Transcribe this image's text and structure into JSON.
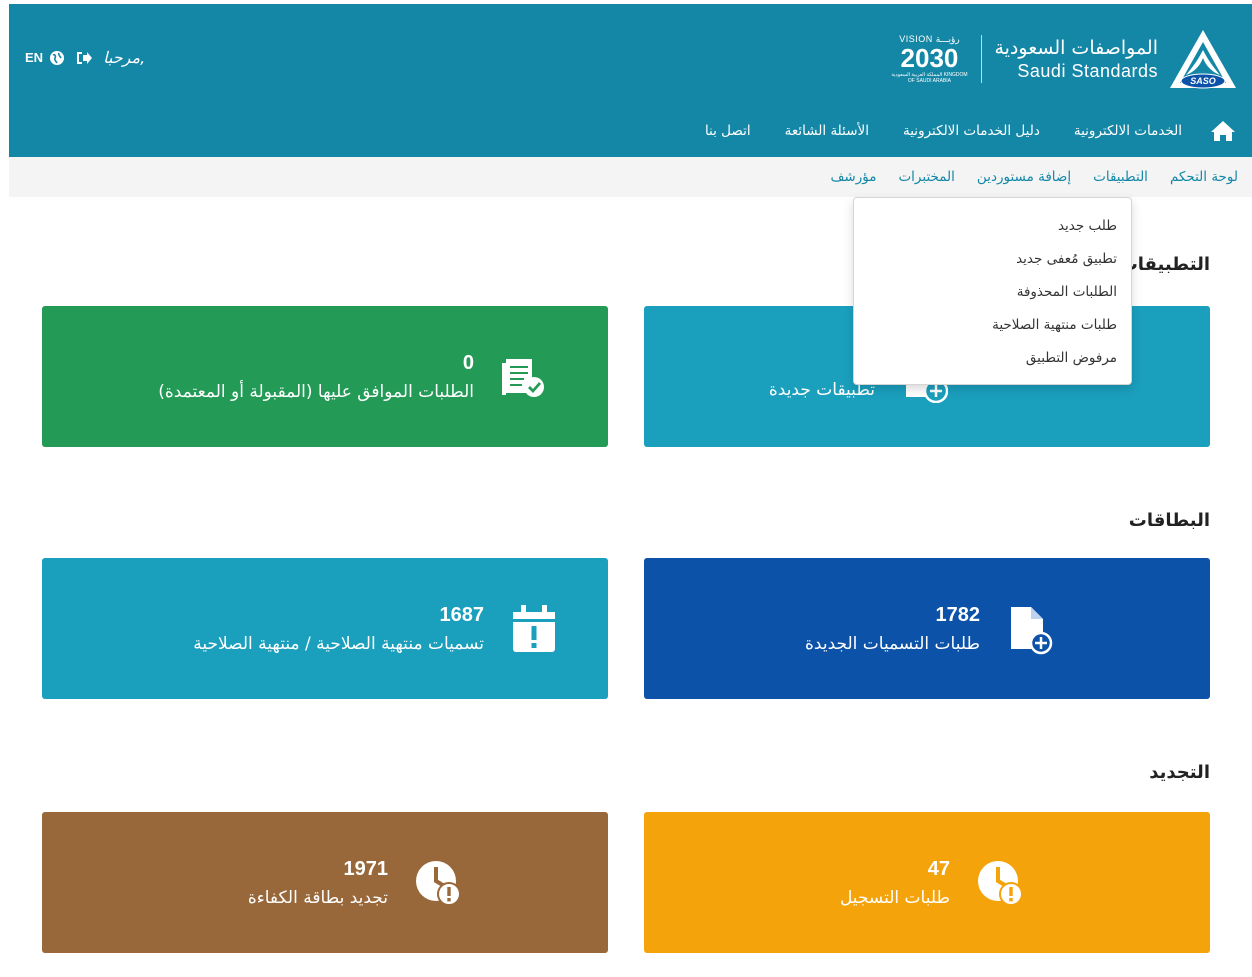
{
  "header": {
    "brand_ar": "المواصفات السعودية",
    "brand_en": "Saudi Standards",
    "logo_text": "SASO",
    "vision_top": "VISION رؤيـــة",
    "vision_year": "2030",
    "vision_sub": "المملكة العربية السعودية KINGDOM OF SAUDI ARABIA",
    "welcome": "مرحبا,",
    "lang": "EN"
  },
  "main_nav": {
    "items": [
      "الخدمات الالكترونية",
      "دليل الخدمات الالكترونية",
      "الأسئلة الشائعة",
      "اتصل بنا"
    ]
  },
  "sub_nav": {
    "items": [
      "لوحة التحكم",
      "التطبيقات",
      "إضافة مستوردين",
      "المختبرات",
      "مؤرشف"
    ]
  },
  "dropdown": {
    "items": [
      "طلب جديد",
      "تطبيق مُعفى جديد",
      "الطلبات المحذوفة",
      "طلبات منتهية الصلاحية",
      "مرفوض التطبيق"
    ]
  },
  "sections": {
    "applications": "التطبيقات",
    "cards": "البطاقات",
    "renewal": "التجديد"
  },
  "cards": {
    "new_apps": {
      "count": "",
      "label": "تطبيقات جديدة",
      "color": "#1a9fbd"
    },
    "approved": {
      "count": "0",
      "label": "الطلبات الموافق عليها (المقبولة أو المعتمدة)",
      "color": "#239b56"
    },
    "new_labels": {
      "count": "1782",
      "label": "طلبات التسميات الجديدة",
      "color": "#0b52a8"
    },
    "expired_labels": {
      "count": "1687",
      "label": "تسميات منتهية الصلاحية / منتهية الصلاحية",
      "color": "#1a9fbd"
    },
    "registration": {
      "count": "47",
      "label": "طلبات التسجيل",
      "color": "#f5a30a"
    },
    "competency": {
      "count": "1971",
      "label": "تجديد بطاقة الكفاءة",
      "color": "#98683a"
    }
  }
}
